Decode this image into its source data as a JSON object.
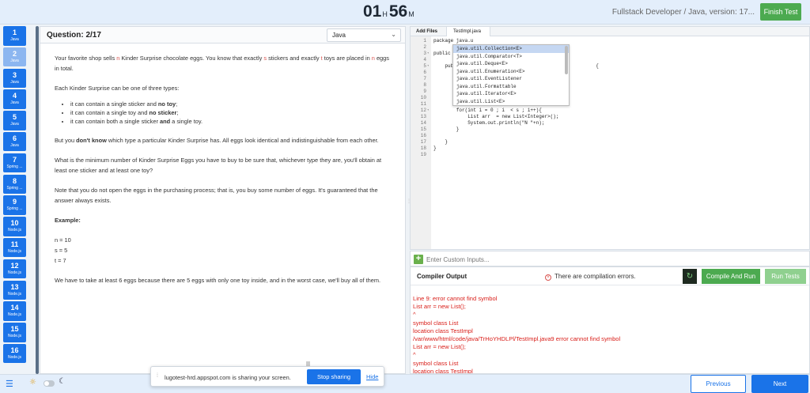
{
  "header": {
    "hours": "01",
    "hours_unit": "H",
    "minutes": "56",
    "minutes_unit": "M",
    "role": "Fullstack Developer / Java, version: 17...",
    "finish_label": "Finish Test"
  },
  "question_nav": [
    {
      "n": "1",
      "tag": "Java"
    },
    {
      "n": "2",
      "tag": "Java"
    },
    {
      "n": "3",
      "tag": "Java"
    },
    {
      "n": "4",
      "tag": "Java"
    },
    {
      "n": "5",
      "tag": "Java"
    },
    {
      "n": "6",
      "tag": "Java"
    },
    {
      "n": "7",
      "tag": "Spring ..."
    },
    {
      "n": "8",
      "tag": "Spring ..."
    },
    {
      "n": "9",
      "tag": "Spring ..."
    },
    {
      "n": "10",
      "tag": "Node.js"
    },
    {
      "n": "11",
      "tag": "Node.js"
    },
    {
      "n": "12",
      "tag": "Node.js"
    },
    {
      "n": "13",
      "tag": "Node.js"
    },
    {
      "n": "14",
      "tag": "Node.js"
    },
    {
      "n": "15",
      "tag": "Node.js"
    },
    {
      "n": "16",
      "tag": "Node.js"
    }
  ],
  "question": {
    "title": "Question: 2/17",
    "language": "Java",
    "p1_a": "Your favorite shop sells ",
    "p1_n": "n",
    "p1_b": " Kinder Surprise chocolate eggs. You know that exactly ",
    "p1_s": "s",
    "p1_c": " stickers and exactly ",
    "p1_t": "t",
    "p1_d": " toys are placed in ",
    "p1_n2": "n",
    "p1_e": " eggs in total.",
    "p2": "Each Kinder Surprise can be one of three types:",
    "b1_a": "it can contain a single sticker and ",
    "b1_b": "no toy",
    "b1_c": ";",
    "b2_a": "it can contain a single toy and ",
    "b2_b": "no sticker",
    "b2_c": ";",
    "b3_a": "it can contain both a single sticker ",
    "b3_b": "and",
    "b3_c": " a single toy.",
    "p3_a": "But you ",
    "p3_b": "don't know",
    "p3_c": " which type a particular Kinder Surprise has. All eggs look identical and indistinguishable from each other.",
    "p4": "What is the minimum number of Kinder Surprise Eggs you have to buy to be sure that, whichever type they are, you'll obtain at least one sticker and at least one toy?",
    "p5": "Note that you do not open the eggs in the purchasing process; that is, you buy some number of eggs. It's guaranteed that the answer always exists.",
    "example_label": "Example:",
    "ex1": "n = 10",
    "ex2": "s = 5",
    "ex3": "t = 7",
    "p6": "We have to take at least 6 eggs because there are 5 eggs with only one toy inside, and in the worst case, we'll buy all of them."
  },
  "editor": {
    "tab_add": "Add Files",
    "tab_file": "TestImpl.java",
    "lines": [
      {
        "n": "1",
        "fold": "",
        "text": "package java.u"
      },
      {
        "n": "2",
        "fold": "",
        "text": ""
      },
      {
        "n": "3",
        "fold": "▾",
        "text": "public"
      },
      {
        "n": "4",
        "fold": "",
        "text": ""
      },
      {
        "n": "5",
        "fold": "▾",
        "text": "    pub                                                  {"
      },
      {
        "n": "6",
        "fold": "",
        "text": ""
      },
      {
        "n": "7",
        "fold": "",
        "text": ""
      },
      {
        "n": "8",
        "fold": "",
        "text": ""
      },
      {
        "n": "9",
        "fold": "",
        "text": ""
      },
      {
        "n": "10",
        "fold": "",
        "text": ""
      },
      {
        "n": "11",
        "fold": "",
        "text": ""
      },
      {
        "n": "12",
        "fold": "▾",
        "text": "        for(int i = 0 ; i  < s ; i++){"
      },
      {
        "n": "13",
        "fold": "",
        "text": "            List arr  = new List<Integer>();"
      },
      {
        "n": "14",
        "fold": "",
        "text": "            System.out.println(\"N \"+n);"
      },
      {
        "n": "15",
        "fold": "",
        "text": "        }"
      },
      {
        "n": "16",
        "fold": "",
        "text": ""
      },
      {
        "n": "17",
        "fold": "",
        "text": "    }"
      },
      {
        "n": "18",
        "fold": "",
        "text": "}"
      },
      {
        "n": "19",
        "fold": "",
        "text": ""
      }
    ],
    "autocomplete": [
      "java.util.Collection<E>",
      "java.util.Comparator<T>",
      "java.util.Deque<E>",
      "java.util.Enumeration<E>",
      "java.util.EventListener",
      "java.util.Formattable",
      "java.util.Iterator<E>",
      "java.util.List<E>"
    ]
  },
  "custom_input": {
    "placeholder": "Enter Custom Inputs..."
  },
  "output": {
    "title": "Compiler Output",
    "status": "There are compilation errors.",
    "reset_icon": "refresh-icon",
    "run_label": "Compile And Run",
    "tests_label": "Run Tests",
    "lines": [
      "Line 9: error cannot find symbol",
      "List arr = new List();",
      "^",
      "symbol class List",
      "location class TestImpl",
      "/var/www/html/code/java/TrHoYHDLPl/TestImpl.java9 error cannot find symbol",
      "List arr = new List();",
      "^",
      "symbol class List",
      "location class TestImpl"
    ]
  },
  "share_bar": {
    "message": "lugotest-hrd.appspot.com is sharing your screen.",
    "stop_label": "Stop sharing",
    "hide_label": "Hide"
  },
  "footer": {
    "previous_label": "Previous",
    "next_label": "Next"
  },
  "colors": {
    "primary": "#1a73e8",
    "success": "#4caa50",
    "error": "#d9201b"
  }
}
